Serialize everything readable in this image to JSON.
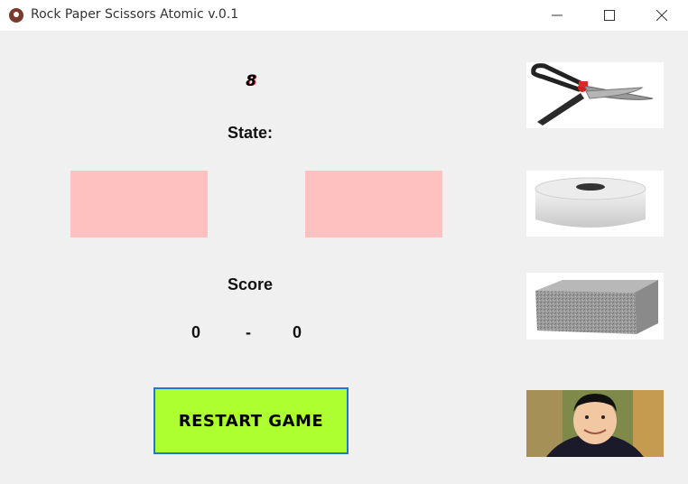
{
  "window": {
    "title": "Rock Paper Scissors Atomic v.0.1",
    "controls": [
      "minimize",
      "maximize",
      "close"
    ]
  },
  "game": {
    "counter": "8",
    "state_label": "State:",
    "score_label": "Score",
    "score_left": "0",
    "score_separator": "-",
    "score_right": "0",
    "restart_label": "RESTART GAME"
  },
  "choices": [
    {
      "name": "scissors",
      "icon": "scissors-image"
    },
    {
      "name": "paper",
      "icon": "paper-roll-image"
    },
    {
      "name": "rock",
      "icon": "rock-brick-image"
    },
    {
      "name": "atomic",
      "icon": "person-portrait-image"
    }
  ],
  "colors": {
    "slot": "#ffc0c0",
    "restart_bg": "#adff2f",
    "restart_border": "#1e78d2"
  }
}
